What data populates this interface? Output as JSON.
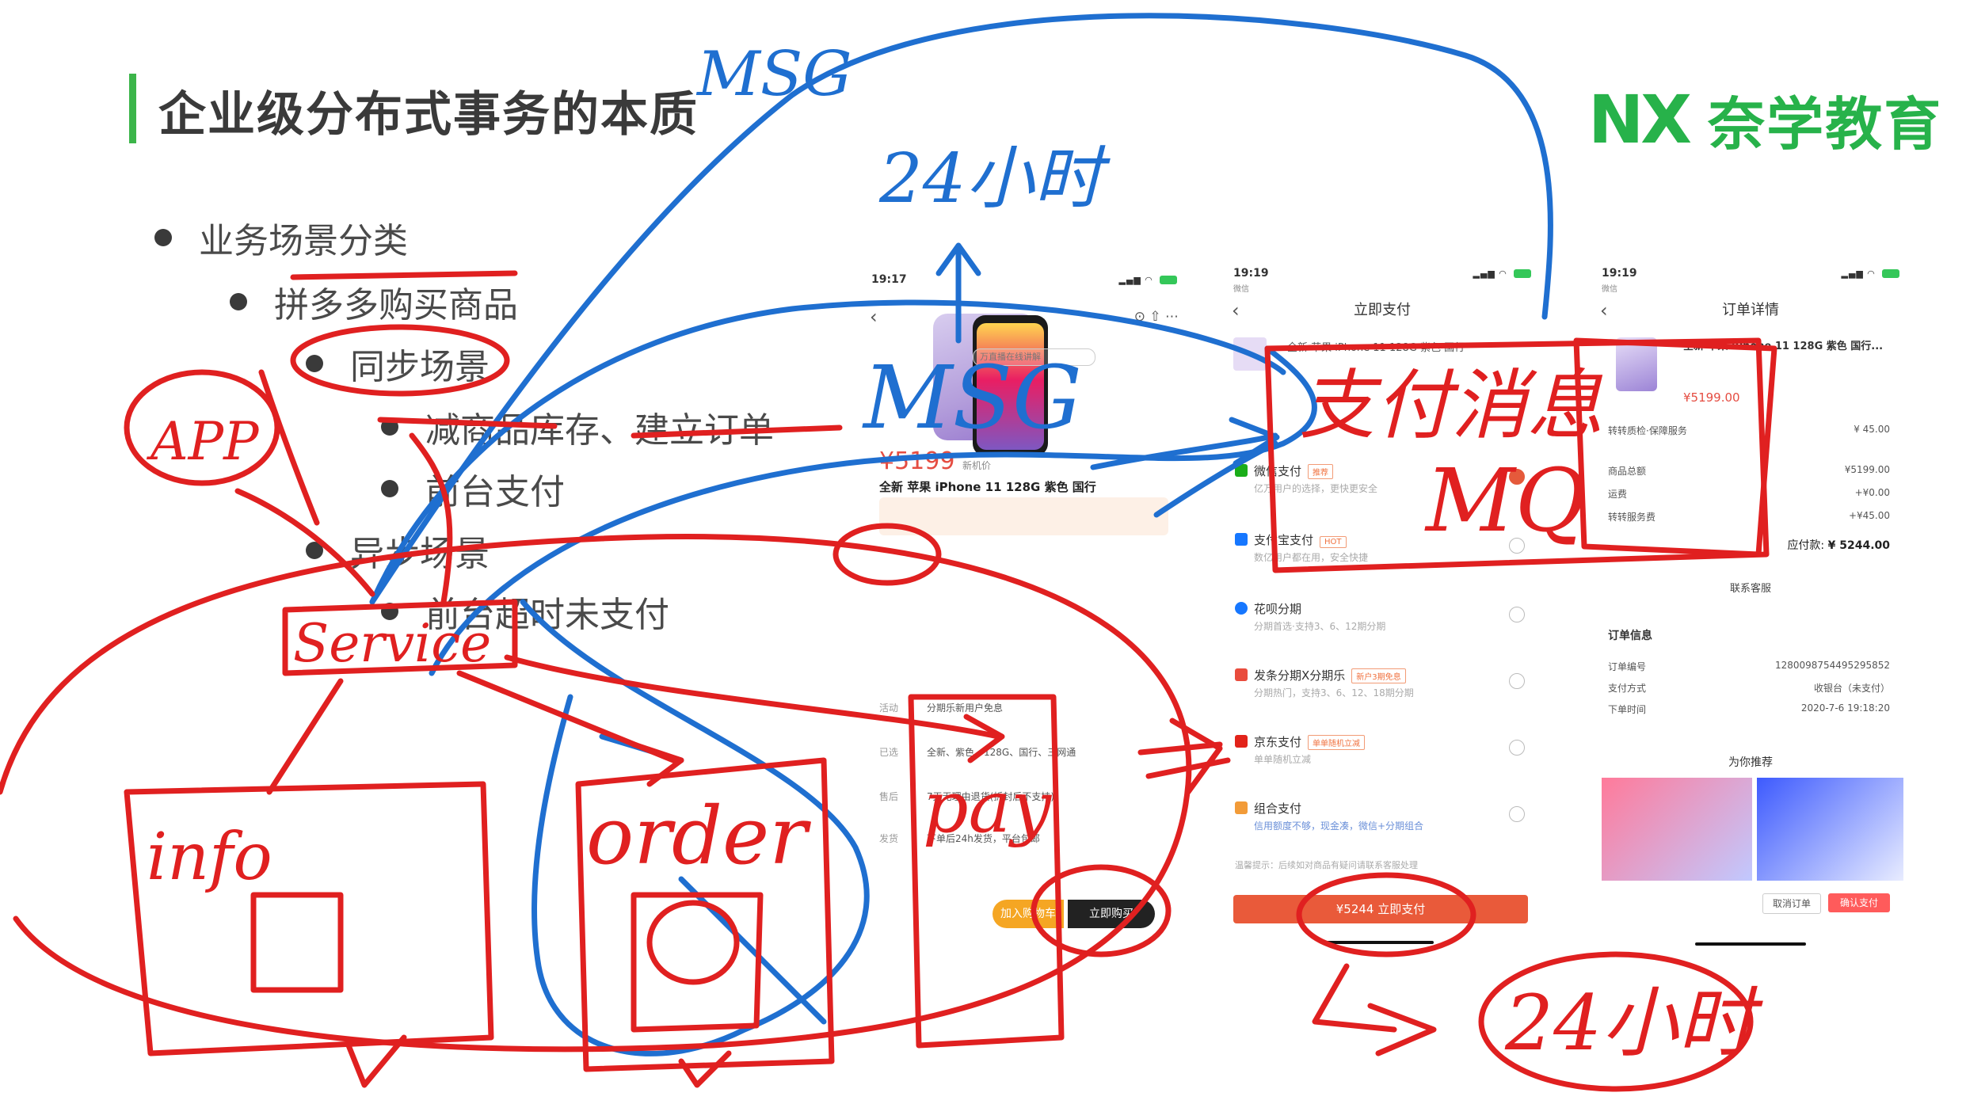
{
  "slide": {
    "title": "企业级分布式事务的本质",
    "brand_mark": "NX",
    "brand_name": "奈学教育",
    "bullets": [
      {
        "text": "业务场景分类",
        "level": 1
      },
      {
        "text": "拼多多购买商品",
        "level": 2
      },
      {
        "text": "同步场景",
        "level": 3
      },
      {
        "text": "减商品库存、建立订单",
        "level": 4
      },
      {
        "text": "前台支付",
        "level": 4
      },
      {
        "text": "异步场景",
        "level": 3
      },
      {
        "text": "前台超时未支付",
        "level": 4
      }
    ]
  },
  "phone1": {
    "time": "19:17",
    "live": "万直播在线讲解",
    "price": "¥5199",
    "price_tag": "新机价",
    "title": "全新 苹果 iPhone 11 128G 紫色 国行",
    "rows": [
      {
        "k": "活动",
        "v": "分期乐新用户免息"
      },
      {
        "k": "已选",
        "v": "全新、紫色、128G、国行、三网通"
      },
      {
        "k": "售后",
        "v": "7天无理由退货(拆封后不支持)"
      },
      {
        "k": "发货",
        "v": "下单后24h发货，平台包邮"
      }
    ],
    "add_cart": "加入购物车",
    "buy_now": "立即购买"
  },
  "phone2": {
    "time": "19:19",
    "carrier": "微信",
    "title": "立即支付",
    "product": "全新 苹果 iPhone 11 128G 紫色 国行",
    "items": [
      {
        "name": "微信支付",
        "tag": "推荐",
        "desc": "亿万用户的选择，更快更安全",
        "selected": true
      },
      {
        "name": "支付宝支付",
        "tag": "HOT",
        "desc": "数亿用户都在用，安全快捷",
        "selected": false
      },
      {
        "name": "花呗分期",
        "tag": "",
        "desc": "分期首选·支持3、6、12期分期",
        "selected": false
      },
      {
        "name": "发条分期X分期乐",
        "tag": "新户3期免息",
        "desc": "分期热门，支持3、6、12、18期分期",
        "selected": false
      },
      {
        "name": "京东支付",
        "tag": "单单随机立减",
        "desc": "单单随机立减",
        "selected": false
      },
      {
        "name": "组合支付",
        "tag": "",
        "desc": "信用额度不够，现金凑，微信+分期组合",
        "selected": false
      }
    ],
    "note": "温馨提示：后续如对商品有疑问请联系客服处理",
    "pay_button": "¥5244 立即支付"
  },
  "phone3": {
    "time": "19:19",
    "carrier": "微信",
    "title": "订单详情",
    "product": "全新 苹果 iPhone 11 128G 紫色 国行...",
    "price": "¥5199.00",
    "service": "转转质检·保障服务",
    "service_fee": "¥ 45.00",
    "lines": [
      {
        "k": "商品总额",
        "v": "¥5199.00"
      },
      {
        "k": "运费",
        "v": "+¥0.00"
      },
      {
        "k": "转转服务费",
        "v": "+¥45.00"
      }
    ],
    "payable_label": "应付款:",
    "payable": "¥ 5244.00",
    "contact": "联系客服",
    "order_info": "订单信息",
    "info": [
      {
        "k": "订单编号",
        "v": "1280098754495295852"
      },
      {
        "k": "支付方式",
        "v": "收银台（未支付）"
      },
      {
        "k": "下单时间",
        "v": "2020-7-6 19:18:20"
      }
    ],
    "recommend": "为你推荐",
    "cancel": "取消订单",
    "confirm": "确认支付"
  },
  "handwriting": {
    "msg_top": "MSG",
    "h24_top": "24小时",
    "msg_mid": "MSG",
    "app": "APP",
    "service": "Service",
    "info": "info",
    "order": "order",
    "pay": "pay",
    "pay_msg": "支付消息",
    "mq": "MQ",
    "h24_bottom": "24小时"
  }
}
